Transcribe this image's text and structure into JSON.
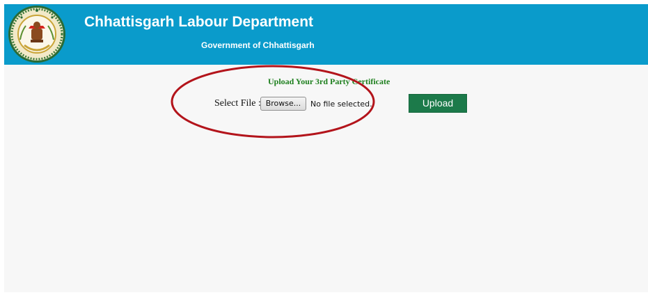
{
  "header": {
    "title": "Chhattisgarh Labour Department",
    "subtitle": "Government of Chhattisgarh",
    "logo_icon": "state-emblem-icon",
    "background_color": "#0a9bcb"
  },
  "upload_form": {
    "heading": "Upload Your 3rd Party Certificate",
    "select_label": "Select File :",
    "browse_label": "Browse...",
    "file_status": "No file selected.",
    "upload_label": "Upload",
    "heading_color": "#1d7f1d",
    "upload_button_color": "#1c7a4a"
  },
  "annotation": {
    "shape": "oval",
    "color": "#b3141b"
  }
}
